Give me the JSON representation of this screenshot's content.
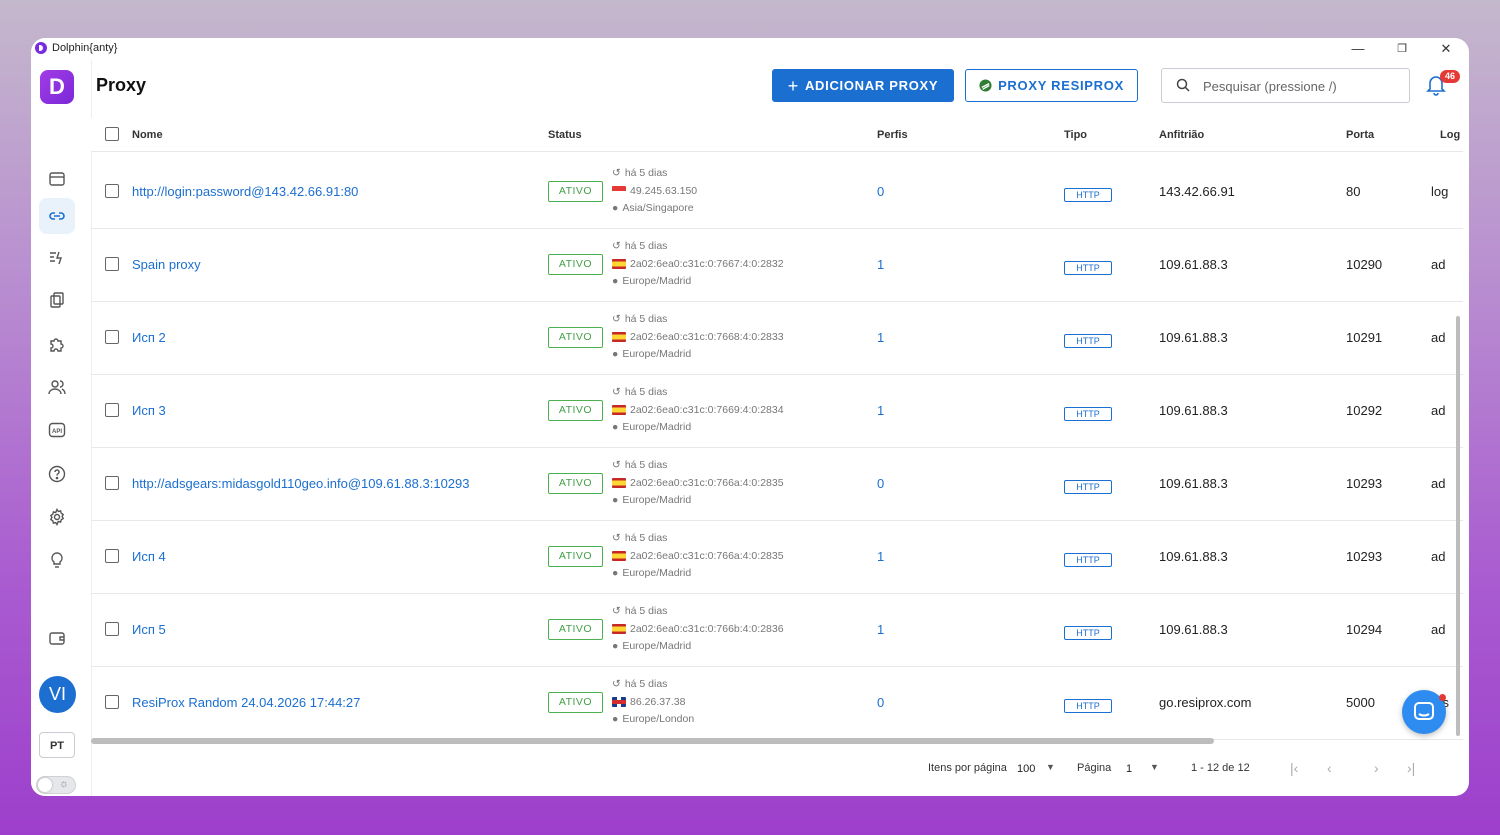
{
  "window": {
    "title": "Dolphin{anty}",
    "controls": [
      "—",
      "❐",
      "✕"
    ]
  },
  "page": {
    "title": "Proxy"
  },
  "header": {
    "add_label": "ADICIONAR PROXY",
    "resiprox_label": "PROXY RESIPROX",
    "search_placeholder": "Pesquisar (pressione /)",
    "notifications": "46"
  },
  "sidebar": {
    "brand": "D",
    "items": [
      {
        "name": "browser-profiles",
        "icon": "browser-icon"
      },
      {
        "name": "proxy",
        "icon": "link-icon",
        "active": true
      },
      {
        "name": "automation",
        "icon": "automation-icon"
      },
      {
        "name": "extensions",
        "icon": "copy-icon"
      },
      {
        "name": "puzzle",
        "icon": "puzzle-icon"
      },
      {
        "name": "team",
        "icon": "users-icon"
      },
      {
        "name": "api",
        "icon": "api-icon"
      },
      {
        "name": "help",
        "icon": "help-icon"
      },
      {
        "name": "settings",
        "icon": "gear-icon"
      },
      {
        "name": "tips",
        "icon": "lightbulb-icon"
      },
      {
        "name": "wallet",
        "icon": "wallet-icon"
      }
    ],
    "avatar": "VI",
    "language": "PT"
  },
  "table": {
    "columns": [
      "Nome",
      "Status",
      "Perfis",
      "Tipo",
      "Anfitrião",
      "Porta",
      "Log"
    ],
    "rows": [
      {
        "name": "http://login:password@143.42.66.91:80",
        "status": "ATIVO",
        "checked": "há 5 dias",
        "flag": "sg",
        "ip": "49.245.63.150",
        "tz": "Asia/Singapore",
        "profiles": "0",
        "type": "HTTP",
        "host": "143.42.66.91",
        "port": "80",
        "login": "log"
      },
      {
        "name": "Spain proxy",
        "status": "ATIVO",
        "checked": "há 5 dias",
        "flag": "es",
        "ip": "2a02:6ea0:c31c:0:7667:4:0:2832",
        "tz": "Europe/Madrid",
        "profiles": "1",
        "type": "HTTP",
        "host": "109.61.88.3",
        "port": "10290",
        "login": "ad"
      },
      {
        "name": "Исп 2",
        "status": "ATIVO",
        "checked": "há 5 dias",
        "flag": "es",
        "ip": "2a02:6ea0:c31c:0:7668:4:0:2833",
        "tz": "Europe/Madrid",
        "profiles": "1",
        "type": "HTTP",
        "host": "109.61.88.3",
        "port": "10291",
        "login": "ad"
      },
      {
        "name": "Исп 3",
        "status": "ATIVO",
        "checked": "há 5 dias",
        "flag": "es",
        "ip": "2a02:6ea0:c31c:0:7669:4:0:2834",
        "tz": "Europe/Madrid",
        "profiles": "1",
        "type": "HTTP",
        "host": "109.61.88.3",
        "port": "10292",
        "login": "ad"
      },
      {
        "name": "http://adsgears:midasgold110geo.info@109.61.88.3:10293",
        "status": "ATIVO",
        "checked": "há 5 dias",
        "flag": "es",
        "ip": "2a02:6ea0:c31c:0:766a:4:0:2835",
        "tz": "Europe/Madrid",
        "profiles": "0",
        "type": "HTTP",
        "host": "109.61.88.3",
        "port": "10293",
        "login": "ad"
      },
      {
        "name": "Исп 4",
        "status": "ATIVO",
        "checked": "há 5 dias",
        "flag": "es",
        "ip": "2a02:6ea0:c31c:0:766a:4:0:2835",
        "tz": "Europe/Madrid",
        "profiles": "1",
        "type": "HTTP",
        "host": "109.61.88.3",
        "port": "10293",
        "login": "ad"
      },
      {
        "name": "Исп 5",
        "status": "ATIVO",
        "checked": "há 5 dias",
        "flag": "es",
        "ip": "2a02:6ea0:c31c:0:766b:4:0:2836",
        "tz": "Europe/Madrid",
        "profiles": "1",
        "type": "HTTP",
        "host": "109.61.88.3",
        "port": "10294",
        "login": "ad"
      },
      {
        "name": "ResiProx Random 24.04.2026 17:44:27",
        "status": "ATIVO",
        "checked": "há 5 dias",
        "flag": "gb",
        "ip": "86.26.37.38",
        "tz": "Europe/London",
        "profiles": "0",
        "type": "HTTP",
        "host": "go.resiprox.com",
        "port": "5000",
        "login": "res"
      }
    ]
  },
  "pagination": {
    "per_page_label": "Itens por página",
    "per_page": "100",
    "page_label": "Página",
    "page": "1",
    "range": "1 - 12 de 12"
  },
  "colors": {
    "accent": "#1b6fd0",
    "active_green": "#43a047",
    "brand": "#8a30e0"
  }
}
